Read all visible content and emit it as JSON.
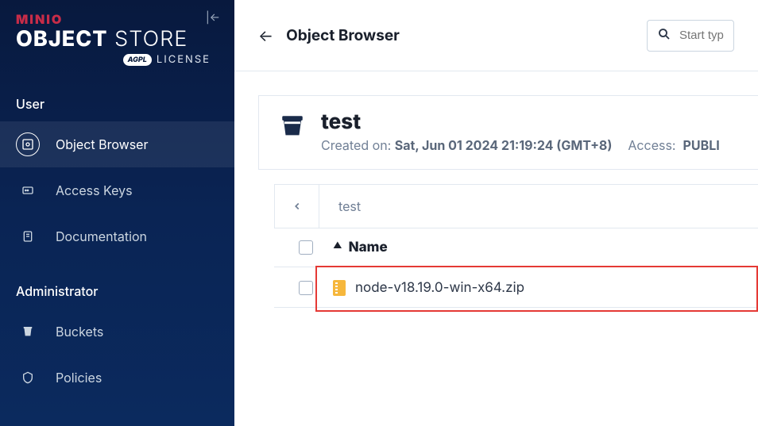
{
  "brand": {
    "min": "MINIO",
    "object": "OBJECT",
    "store": "STORE",
    "agpl": "AGPL",
    "license": "LICENSE"
  },
  "sidebar": {
    "sections": [
      {
        "title": "User",
        "items": [
          {
            "label": "Object Browser",
            "name": "object-browser",
            "active": true
          },
          {
            "label": "Access Keys",
            "name": "access-keys",
            "active": false
          },
          {
            "label": "Documentation",
            "name": "documentation",
            "active": false
          }
        ]
      },
      {
        "title": "Administrator",
        "items": [
          {
            "label": "Buckets",
            "name": "buckets",
            "active": false
          },
          {
            "label": "Policies",
            "name": "policies",
            "active": false
          }
        ]
      }
    ]
  },
  "header": {
    "title": "Object Browser",
    "search_placeholder": "Start typ"
  },
  "bucket": {
    "name": "test",
    "created_label": "Created on:",
    "created_value": "Sat, Jun 01 2024 21:19:24 (GMT+8)",
    "access_label": "Access:",
    "access_value": "PUBLI"
  },
  "breadcrumb": {
    "path": "test"
  },
  "table": {
    "columns": {
      "name": "Name"
    },
    "rows": [
      {
        "name": "node-v18.19.0-win-x64.zip"
      }
    ]
  }
}
